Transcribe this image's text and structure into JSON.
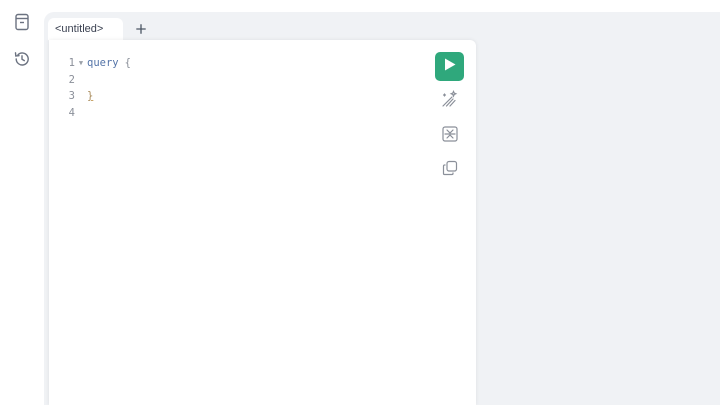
{
  "sidebar": {
    "items": [
      {
        "icon": "docs-icon"
      },
      {
        "icon": "history-icon"
      }
    ]
  },
  "tabs": [
    {
      "label": "<untitled>",
      "active": true
    }
  ],
  "add_tab_icon": "plus-icon",
  "editor": {
    "lines": [
      {
        "number": "1",
        "foldable": true,
        "keyword": "query",
        "brace": "{"
      },
      {
        "number": "2",
        "foldable": false,
        "keyword": "",
        "brace": ""
      },
      {
        "number": "3",
        "foldable": false,
        "keyword": "",
        "brace": "}"
      },
      {
        "number": "4",
        "foldable": false,
        "keyword": "",
        "brace": ""
      }
    ]
  },
  "toolbar": {
    "run_icon": "play-icon",
    "prettify_icon": "magic-wand-icon",
    "merge_icon": "merge-fragments-icon",
    "copy_icon": "copy-icon"
  },
  "colors": {
    "run_button": "#2fa87c",
    "keyword": "#5474a8",
    "workspace_bg": "#f0f2f5"
  }
}
